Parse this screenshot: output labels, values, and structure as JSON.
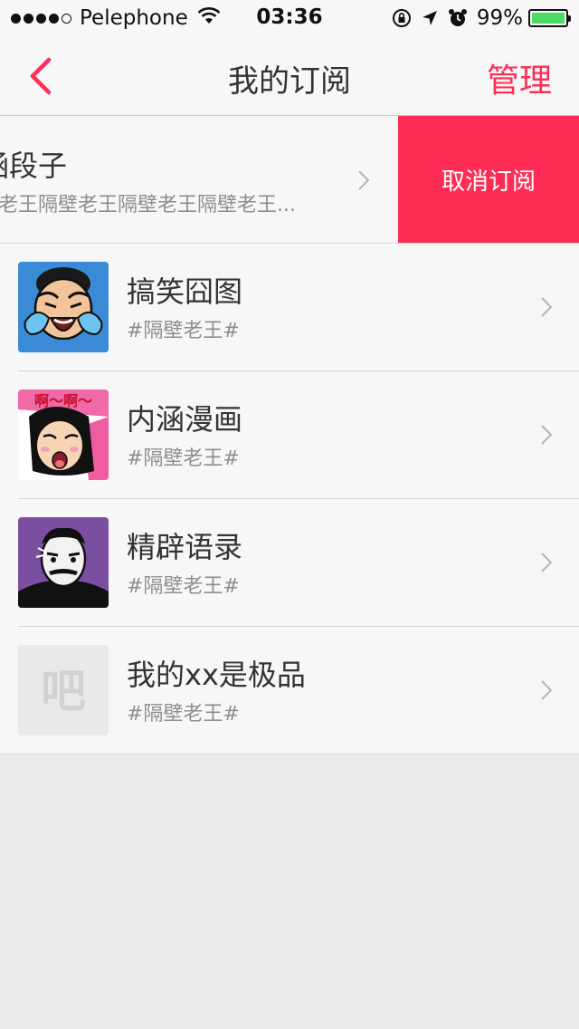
{
  "status_bar": {
    "carrier": "Pelephone",
    "time": "03:36",
    "battery": "99%",
    "battery_level": 0.99,
    "signal_bars_filled": 4,
    "signal_bars_total": 5
  },
  "nav": {
    "title": "我的订阅",
    "manage_label": "管理",
    "accent_color": "#ff2d55"
  },
  "subscriptions": [
    {
      "title": "涵段子",
      "subtitle": "老王隔壁老王隔壁老王隔壁老王...",
      "action_label": "取消订阅",
      "icon": "none"
    },
    {
      "title": "搞笑囧图",
      "subtitle": "#隔壁老王#",
      "icon": "crying-face-thumbnail"
    },
    {
      "title": "内涵漫画",
      "subtitle": "#隔壁老王#",
      "icon": "comic-girl-thumbnail",
      "icon_text": "啊～啊～"
    },
    {
      "title": "精辟语录",
      "subtitle": "#隔壁老王#",
      "icon": "luxun-portrait-thumbnail"
    },
    {
      "title": "我的xx是极品",
      "subtitle": "#隔壁老王#",
      "icon": "placeholder-ba-thumbnail",
      "icon_text": "吧"
    }
  ]
}
